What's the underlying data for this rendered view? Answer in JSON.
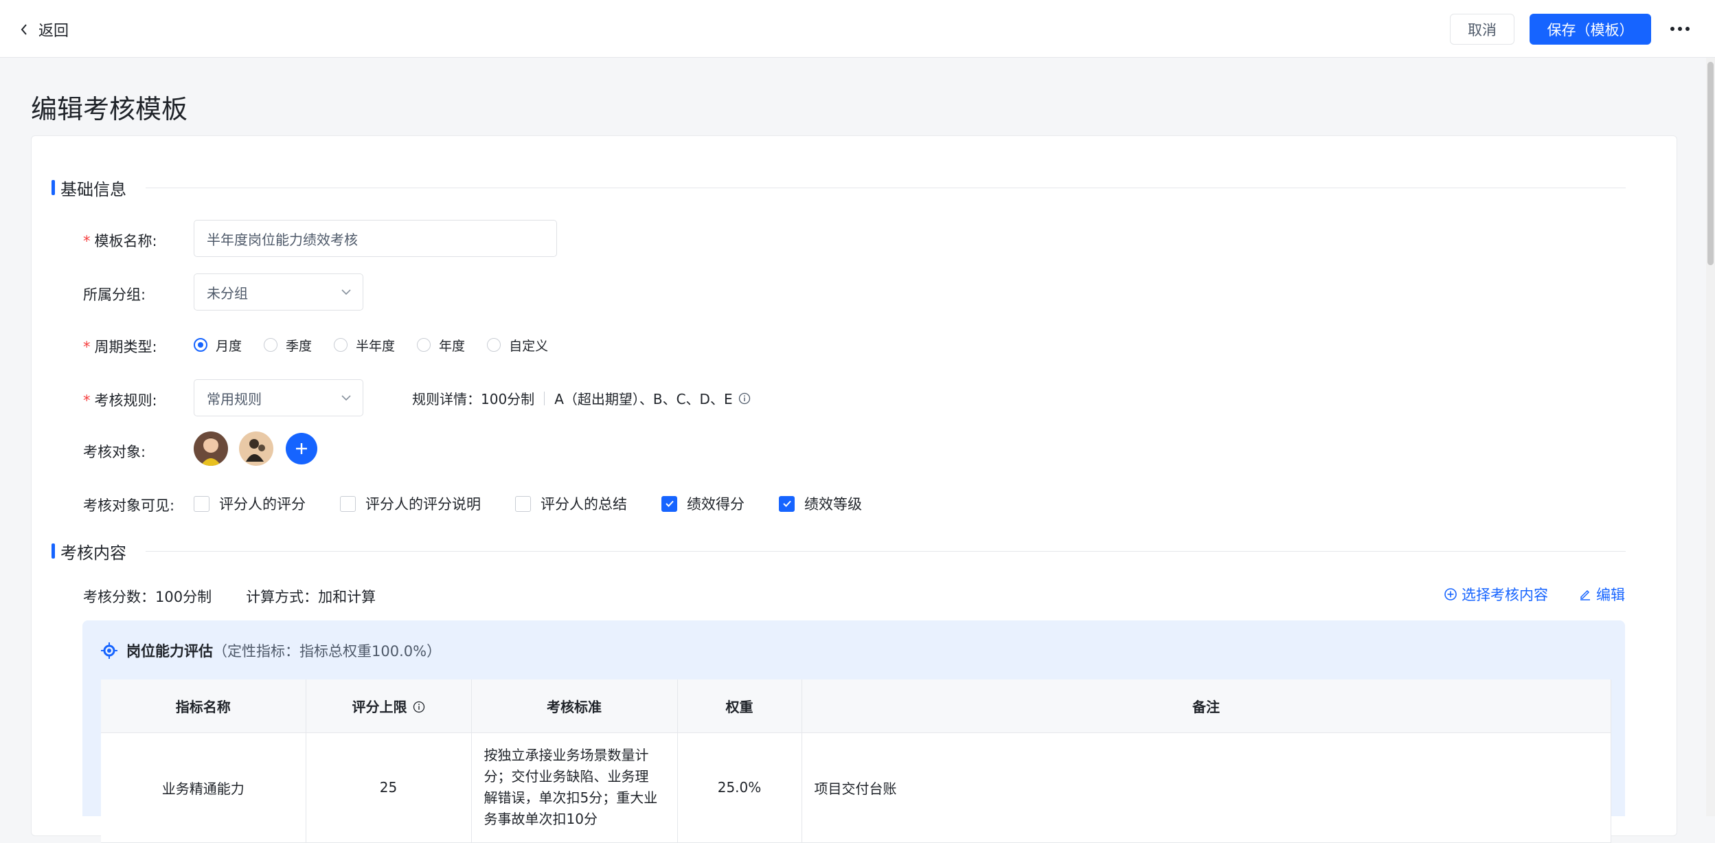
{
  "header": {
    "back_label": "返回",
    "cancel_label": "取消",
    "save_label": "保存（模板）"
  },
  "page_title": "编辑考核模板",
  "basic": {
    "section_title": "基础信息",
    "name_label": "模板名称:",
    "name_value": "半年度岗位能力绩效考核",
    "group_label": "所属分组:",
    "group_value": "未分组",
    "cycle_label": "周期类型:",
    "cycle_options": [
      "月度",
      "季度",
      "半年度",
      "年度",
      "自定义"
    ],
    "cycle_selected": "月度",
    "rule_label": "考核规则:",
    "rule_value": "常用规则",
    "rule_detail_prefix": "规则详情：100分制",
    "rule_detail_grades": "A（超出期望）、B、C、D、E",
    "target_label": "考核对象:",
    "visible_label": "考核对象可见:",
    "visible_options": [
      {
        "label": "评分人的评分",
        "checked": false
      },
      {
        "label": "评分人的评分说明",
        "checked": false
      },
      {
        "label": "评分人的总结",
        "checked": false
      },
      {
        "label": "绩效得分",
        "checked": true
      },
      {
        "label": "绩效等级",
        "checked": true
      }
    ]
  },
  "content": {
    "section_title": "考核内容",
    "score_text": "考核分数：100分制",
    "calc_text": "计算方式：加和计算",
    "select_link": "选择考核内容",
    "edit_link": "编辑",
    "dimension": {
      "name": "岗位能力评估",
      "subtitle": "（定性指标：指标总权重100.0%）",
      "columns": [
        "指标名称",
        "评分上限",
        "考核标准",
        "权重",
        "备注"
      ],
      "rows": [
        {
          "name": "业务精通能力",
          "limit": "25",
          "standard": "按独立承接业务场景数量计分；交付业务缺陷、业务理解错误，单次扣5分；重大业务事故单次扣10分",
          "weight": "25.0%",
          "remark": "项目交付台账"
        }
      ]
    }
  },
  "colors": {
    "primary": "#1664ff",
    "required": "#f53f3f",
    "panel": "#e9f1fe"
  }
}
